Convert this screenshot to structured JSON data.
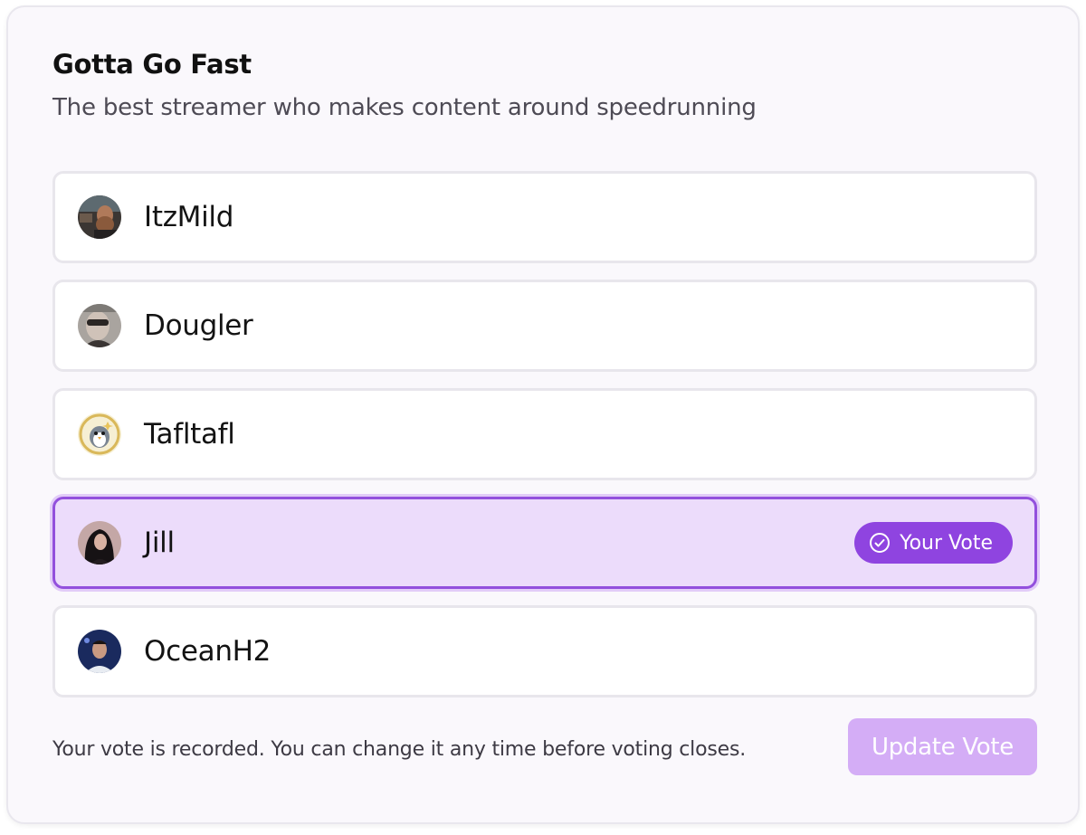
{
  "poll": {
    "title": "Gotta Go Fast",
    "subtitle": "The best streamer who makes content around speedrunning"
  },
  "options": [
    {
      "name": "ItzMild",
      "avatar": "itzmild-avatar",
      "selected": false
    },
    {
      "name": "Dougler",
      "avatar": "dougler-avatar",
      "selected": false
    },
    {
      "name": "Tafltafl",
      "avatar": "tafltafl-avatar",
      "selected": false
    },
    {
      "name": "Jill",
      "avatar": "jill-avatar",
      "selected": true
    },
    {
      "name": "OceanH2",
      "avatar": "oceanh2-avatar",
      "selected": false
    }
  ],
  "badge": {
    "label": "Your Vote",
    "icon": "check-circle-icon"
  },
  "footer": {
    "note": "Your vote is recorded. You can change it any time before voting closes.",
    "update_label": "Update Vote"
  },
  "colors": {
    "accent": "#8f44e0",
    "selected_background": "#ecdcfb",
    "selected_border": "#9350dd",
    "button_disabled": "#d4adf6"
  }
}
